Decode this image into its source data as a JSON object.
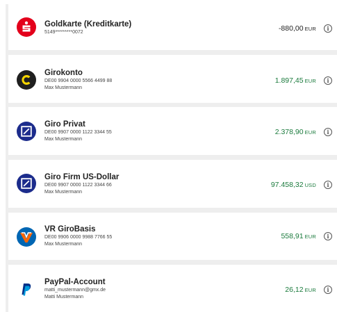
{
  "accounts": [
    {
      "name": "Goldkarte (Kreditkarte)",
      "lines": [
        "5149*********0072"
      ],
      "amount": "-880,00",
      "currency": "EUR",
      "amount_color": "#222222",
      "logo": "sparkasse-icon",
      "logo_color": "#e3001b"
    },
    {
      "name": "Girokonto",
      "lines": [
        "DE00 9904 0000 5566 4499 88",
        "Max Mustermann"
      ],
      "amount": "1.897,45",
      "currency": "EUR",
      "amount_color": "#1a7a3c",
      "logo": "commerzbank-icon",
      "logo_color": "#f5d400"
    },
    {
      "name": "Giro Privat",
      "lines": [
        "DE00 9907 0000 1122 3344 55",
        "Max Mustermann"
      ],
      "amount": "2.378,90",
      "currency": "EUR",
      "amount_color": "#1a7a3c",
      "logo": "deutsche-bank-icon",
      "logo_color": "#1c2c8c"
    },
    {
      "name": "Giro Firm US-Dollar",
      "lines": [
        "DE00 9907 0000 1122 3344 66",
        "Max Mustermann"
      ],
      "amount": "97.458,32",
      "currency": "USD",
      "amount_color": "#1a7a3c",
      "logo": "deutsche-bank-icon",
      "logo_color": "#1c2c8c"
    },
    {
      "name": "VR GiroBasis",
      "lines": [
        "DE00 9906 0000 9988 7766 55",
        "Max Mustermann"
      ],
      "amount": "558,91",
      "currency": "EUR",
      "amount_color": "#1a7a3c",
      "logo": "volksbank-icon",
      "logo_color": "#0066b3"
    },
    {
      "name": "PayPal-Account",
      "lines": [
        "matti_mustermann@gmx.de",
        "Matti Mustermann"
      ],
      "amount": "26,12",
      "currency": "EUR",
      "amount_color": "#1a7a3c",
      "logo": "paypal-icon",
      "logo_color": "#003087"
    }
  ],
  "info_glyph": "i",
  "info_icon": "info-icon"
}
